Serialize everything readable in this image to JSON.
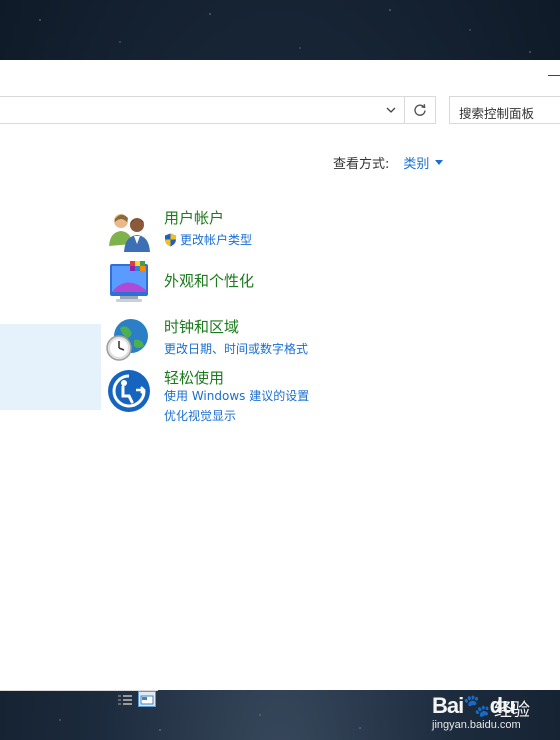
{
  "search": {
    "placeholder": "搜索控制面板"
  },
  "view_by": {
    "label": "查看方式:",
    "value": "类别"
  },
  "categories": [
    {
      "title": "用户帐户",
      "links": [
        "更改帐户类型"
      ],
      "icon": "users-icon"
    },
    {
      "title": "外观和个性化",
      "links": [],
      "icon": "appearance-icon"
    },
    {
      "title": "时钟和区域",
      "links": [
        "更改日期、时间或数字格式"
      ],
      "icon": "clock-globe-icon"
    },
    {
      "title": "轻松使用",
      "links": [
        "使用 Windows 建议的设置",
        "优化视觉显示"
      ],
      "icon": "ease-of-access-icon"
    }
  ],
  "watermark": {
    "logo": "Bai",
    "logo_suffix": "du",
    "cn": "经验",
    "url": "jingyan.baidu.com"
  },
  "colors": {
    "category_title": "#1b7a1b",
    "link": "#1a6fd1",
    "highlight": "#e5f1fb"
  }
}
